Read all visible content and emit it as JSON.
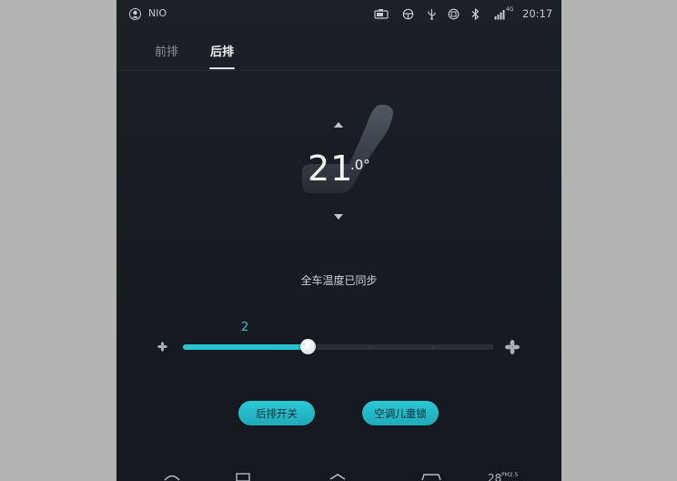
{
  "status_bar": {
    "user_name": "NIO",
    "network": "4G",
    "time": "20:17",
    "icons": [
      "avatar-icon",
      "camera-icon",
      "steering-wheel-icon",
      "usb-icon",
      "hazard-icon",
      "bluetooth-icon",
      "signal-icon"
    ]
  },
  "tabs": [
    {
      "label": "前排",
      "active": false
    },
    {
      "label": "后排",
      "active": true
    }
  ],
  "temperature": {
    "integer": "21",
    "decimal": ".0°",
    "sync_text": "全车温度已同步"
  },
  "fan": {
    "value": "2",
    "level": 2,
    "max_level": 7
  },
  "buttons": {
    "rear_toggle": "后排开关",
    "child_lock": "空调儿童锁"
  },
  "dock": {
    "outside_temp": "28",
    "pm_label": "PM2.5"
  },
  "colors": {
    "accent": "#29c2d0",
    "background": "#1a1e25",
    "letterbox": "#b4b4b4"
  }
}
